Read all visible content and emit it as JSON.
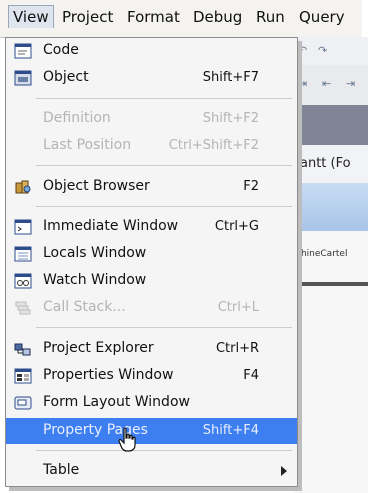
{
  "menubar": {
    "items": [
      "View",
      "Project",
      "Format",
      "Debug",
      "Run",
      "Query"
    ]
  },
  "background": {
    "window_title": "antt (Fo",
    "panel_text": "chineCartel"
  },
  "view_menu": {
    "items": [
      {
        "label": "Code",
        "shortcut": "",
        "icon": "code-window-icon",
        "enabled": true
      },
      {
        "label": "Object",
        "shortcut": "Shift+F7",
        "icon": "object-window-icon",
        "enabled": true
      },
      {
        "label": "Definition",
        "shortcut": "Shift+F2",
        "icon": "",
        "enabled": false
      },
      {
        "label": "Last Position",
        "shortcut": "Ctrl+Shift+F2",
        "icon": "",
        "enabled": false
      },
      {
        "label": "Object Browser",
        "shortcut": "F2",
        "icon": "object-browser-icon",
        "enabled": true
      },
      {
        "label": "Immediate Window",
        "shortcut": "Ctrl+G",
        "icon": "immediate-window-icon",
        "enabled": true
      },
      {
        "label": "Locals Window",
        "shortcut": "",
        "icon": "locals-window-icon",
        "enabled": true
      },
      {
        "label": "Watch Window",
        "shortcut": "",
        "icon": "watch-window-icon",
        "enabled": true
      },
      {
        "label": "Call Stack...",
        "shortcut": "Ctrl+L",
        "icon": "call-stack-icon",
        "enabled": false
      },
      {
        "label": "Project Explorer",
        "shortcut": "Ctrl+R",
        "icon": "project-explorer-icon",
        "enabled": true
      },
      {
        "label": "Properties Window",
        "shortcut": "F4",
        "icon": "properties-window-icon",
        "enabled": true
      },
      {
        "label": "Form Layout Window",
        "shortcut": "",
        "icon": "form-layout-icon",
        "enabled": true
      },
      {
        "label": "Property Pages",
        "shortcut": "Shift+F4",
        "icon": "",
        "enabled": true,
        "selected": true
      },
      {
        "label": "Table",
        "shortcut": "",
        "icon": "",
        "enabled": true,
        "submenu": true
      }
    ]
  }
}
